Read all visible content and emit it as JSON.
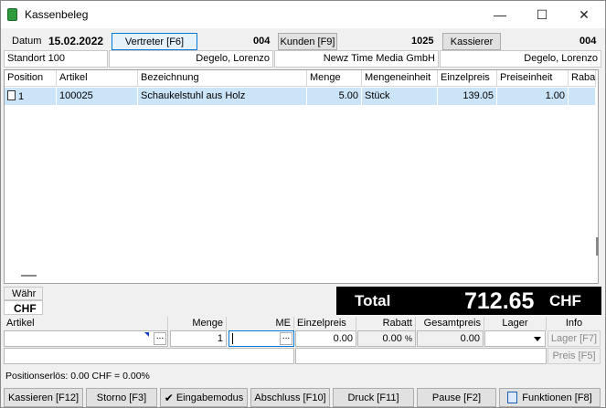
{
  "window": {
    "title": "Kassenbeleg",
    "minimize": "—",
    "maximize": "☐",
    "close": "✕"
  },
  "header": {
    "datum_label": "Datum",
    "datum_value": "15.02.2022",
    "vertreter_button": "Vertreter [F6]",
    "vertreter_code": "004",
    "kunden_button": "Kunden [F9]",
    "kunden_code": "1025",
    "kassierer_button": "Kassierer",
    "kassierer_code": "004",
    "standort": "Standort 100",
    "vertreter_name": "Degelo, Lorenzo",
    "kunden_name": "Newz Time Media GmbH",
    "kassierer_name": "Degelo, Lorenzo"
  },
  "table": {
    "columns": [
      "Position",
      "Artikel",
      "Bezeichnung",
      "Menge",
      "Mengeneinheit",
      "Einzelpreis",
      "Preiseinheit",
      "Raba"
    ],
    "rows": [
      {
        "position": "1",
        "artikel": "100025",
        "bezeichnung": "Schaukelstuhl aus Holz",
        "menge": "5.00",
        "mengeneinheit": "Stück",
        "einzelpreis": "139.05",
        "preiseinheit": "1.00",
        "rabatt": ""
      }
    ]
  },
  "currency": {
    "label": "Währ",
    "value": "CHF"
  },
  "total": {
    "label": "Total",
    "amount": "712.65",
    "currency": "CHF"
  },
  "input": {
    "headers": [
      "Artikel",
      "Menge",
      "ME",
      "Einzelpreis",
      "Rabatt",
      "Gesamtpreis",
      "Lager",
      "Info"
    ],
    "artikel": "",
    "menge": "1",
    "me": "",
    "einzelpreis": "0.00",
    "rabatt": "0.00",
    "rabatt_unit": "%",
    "gesamtpreis": "0.00",
    "lager": "",
    "lager_button": "Lager [F7]",
    "preis_button": "Preis [F5]",
    "ellipsis": "..."
  },
  "status": {
    "positionserloes": "Positionserlös:  0.00 CHF = 0.00%"
  },
  "buttons": [
    "Kassieren [F12]",
    "Storno [F3]",
    "Eingabemodus",
    "Abschluss [F10]",
    "Druck [F11]",
    "Pause [F2]",
    "Funktionen [F8]"
  ]
}
